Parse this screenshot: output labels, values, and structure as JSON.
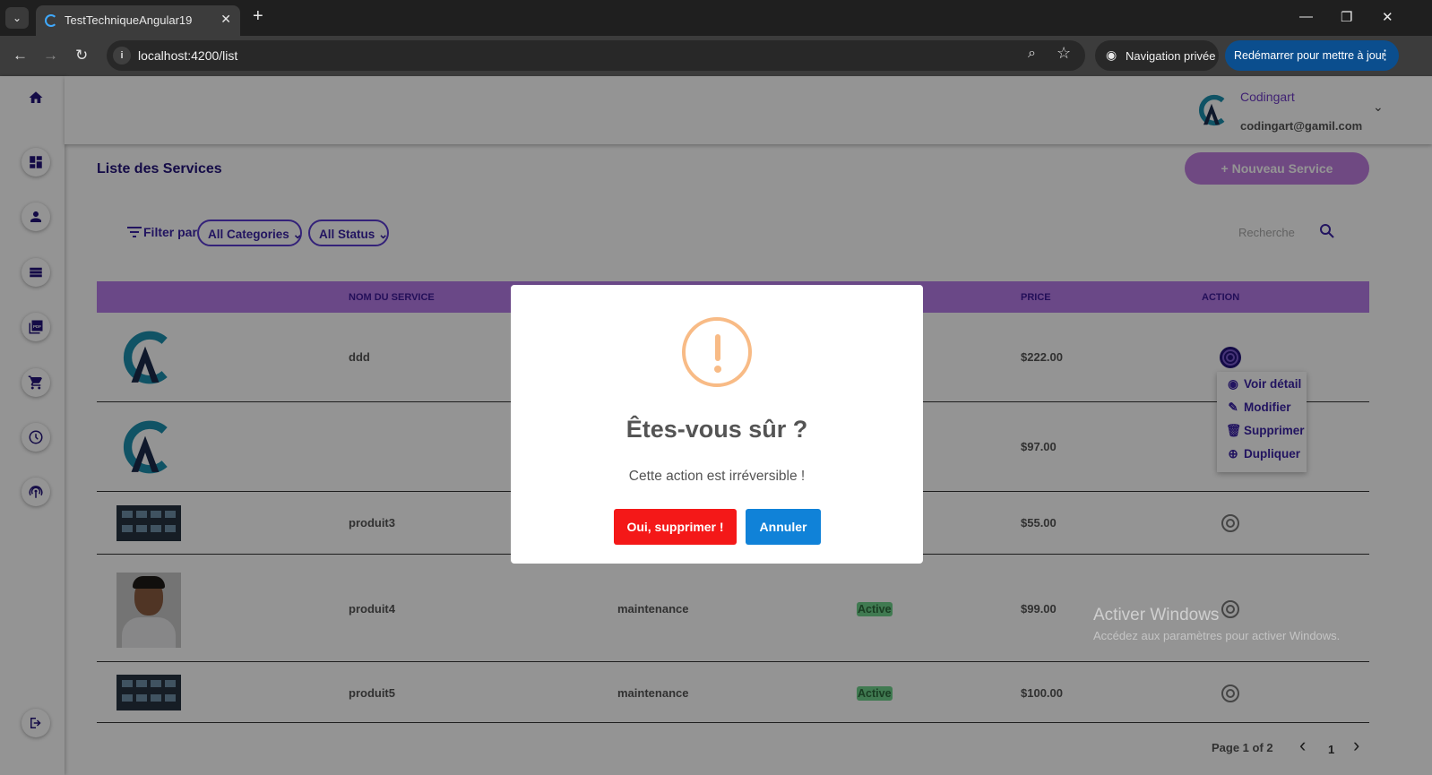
{
  "browser": {
    "tab_title": "TestTechniqueAngular19",
    "tab_close": "✕",
    "new_tab": "+",
    "tab_list": "⌄",
    "url": "localhost:4200/list",
    "private_label": "Navigation privée",
    "update_label": "Redémarrer pour mettre à jour",
    "window_minimize": "—",
    "window_restore": "❐",
    "window_close": "✕"
  },
  "header": {
    "user_name": "Codingart",
    "user_email": "codingart@gamil.com"
  },
  "sidebar": {
    "items": [
      {
        "icon": "home-icon"
      },
      {
        "icon": "dashboard-icon"
      },
      {
        "icon": "user-icon"
      },
      {
        "icon": "list-icon"
      },
      {
        "icon": "pdf-icon"
      },
      {
        "icon": "cart-icon"
      },
      {
        "icon": "clock-icon"
      },
      {
        "icon": "podcast-icon"
      },
      {
        "icon": "logout-icon"
      }
    ]
  },
  "page": {
    "title": "Liste des Services",
    "new_button": "+ Nouveau Service",
    "filter_label": "Filter par",
    "category_select": "All Categories",
    "status_select": "All Status",
    "search_placeholder": "Recherche"
  },
  "table": {
    "headers": {
      "name": "NOM DU SERVICE",
      "price": "PRICE",
      "action": "ACTION"
    },
    "rows": [
      {
        "name": "ddd",
        "category": "",
        "status": "",
        "price": "$222.00"
      },
      {
        "name": "",
        "category": "",
        "status": "",
        "price": "$97.00"
      },
      {
        "name": "produit3",
        "category": "",
        "status": "",
        "price": "$55.00"
      },
      {
        "name": "produit4",
        "category": "maintenance",
        "status": "Active",
        "price": "$99.00"
      },
      {
        "name": "produit5",
        "category": "maintenance",
        "status": "Active",
        "price": "$100.00"
      }
    ]
  },
  "action_menu": {
    "view": "Voir détail",
    "edit": "Modifier",
    "delete": "Supprimer",
    "duplicate": "Dupliquer"
  },
  "pagination": {
    "label": "Page 1 of 2",
    "current": "1",
    "prev": "‹",
    "next": "›"
  },
  "watermark": {
    "line1": "Activer Windows",
    "line2": "Accédez aux paramètres pour activer Windows."
  },
  "modal": {
    "title": "Êtes-vous sûr ?",
    "text": "Cette action est irréversible !",
    "confirm": "Oui, supprimer !",
    "cancel": "Annuler"
  },
  "colors": {
    "accent": "#6f3cc7",
    "table_header": "#b77ce8",
    "confirm_button": "#f41818",
    "cancel_button": "#1082d8",
    "warning": "#f8bb86"
  }
}
